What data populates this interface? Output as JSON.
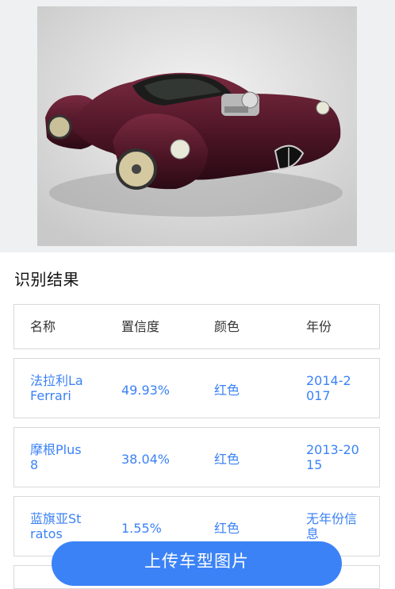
{
  "section_title": "识别结果",
  "table": {
    "headers": [
      "名称",
      "置信度",
      "颜色",
      "年份"
    ],
    "rows": [
      {
        "name": "法拉利La Ferrari",
        "name_l1": "法拉利La",
        "name_l2": "Ferrari",
        "confidence": "49.93%",
        "color": "红色",
        "year_l1": "2014-2",
        "year_l2": "017"
      },
      {
        "name": "摩根Plus 8",
        "name_l1": "摩根Plus",
        "name_l2": "8",
        "confidence": "38.04%",
        "color": "红色",
        "year_l1": "2013-20",
        "year_l2": "15"
      },
      {
        "name": "蓝旗亚Stratos",
        "name_l1": "蓝旗亚St",
        "name_l2": "ratos",
        "confidence": "1.55%",
        "color": "红色",
        "year_l1": "无年份信",
        "year_l2": "息"
      }
    ]
  },
  "upload_button": "上传车型图片",
  "colors": {
    "accent": "#3b82f6",
    "car_body": "#4a1424"
  }
}
